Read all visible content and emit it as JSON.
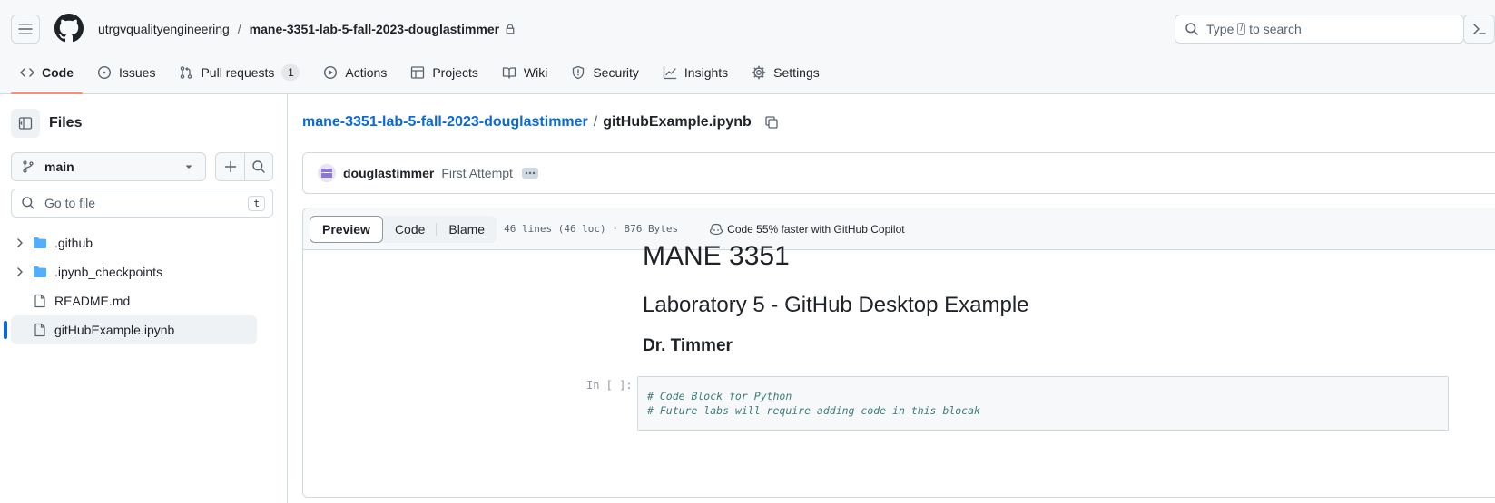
{
  "header": {
    "owner": "utrgvqualityengineering",
    "separator": "/",
    "repo": "mane-3351-lab-5-fall-2023-douglastimmer",
    "search_prefix": "Type",
    "search_key": "/",
    "search_suffix": "to search"
  },
  "tabs": [
    {
      "label": "Code",
      "icon": "code-icon",
      "selected": true
    },
    {
      "label": "Issues",
      "icon": "issue-opened-icon"
    },
    {
      "label": "Pull requests",
      "icon": "git-pull-request-icon",
      "counter": "1"
    },
    {
      "label": "Actions",
      "icon": "play-icon"
    },
    {
      "label": "Projects",
      "icon": "table-icon"
    },
    {
      "label": "Wiki",
      "icon": "book-icon"
    },
    {
      "label": "Security",
      "icon": "shield-icon"
    },
    {
      "label": "Insights",
      "icon": "graph-icon"
    },
    {
      "label": "Settings",
      "icon": "gear-icon"
    }
  ],
  "sidebar": {
    "title": "Files",
    "branch": "main",
    "goto_placeholder": "Go to file",
    "goto_shortcut": "t",
    "tree": [
      {
        "name": ".github",
        "type": "folder"
      },
      {
        "name": ".ipynb_checkpoints",
        "type": "folder"
      },
      {
        "name": "README.md",
        "type": "file"
      },
      {
        "name": "gitHubExample.ipynb",
        "type": "file",
        "active": true
      }
    ]
  },
  "main": {
    "path_repo": "mane-3351-lab-5-fall-2023-douglastimmer",
    "path_sep": "/",
    "path_file": "gitHubExample.ipynb",
    "commit_author": "douglastimmer",
    "commit_message": "First Attempt",
    "view_tabs": [
      "Preview",
      "Code",
      "Blame"
    ],
    "file_info": "46 lines (46 loc) · 876 Bytes",
    "copilot_text": "Code 55% faster with GitHub Copilot"
  },
  "notebook": {
    "h1": "MANE 3351",
    "h2": "Laboratory 5 - GitHub Desktop Example",
    "h3": "Dr. Timmer",
    "prompt": "In [ ]:",
    "code_lines": [
      "# Code Block for Python",
      "# Future labs will require adding code in this blocak"
    ]
  },
  "colors": {
    "accent": "#0969da",
    "tab_underline": "#fd8c73",
    "folder": "#54aeff",
    "code_comment": "#3d7b7b"
  }
}
